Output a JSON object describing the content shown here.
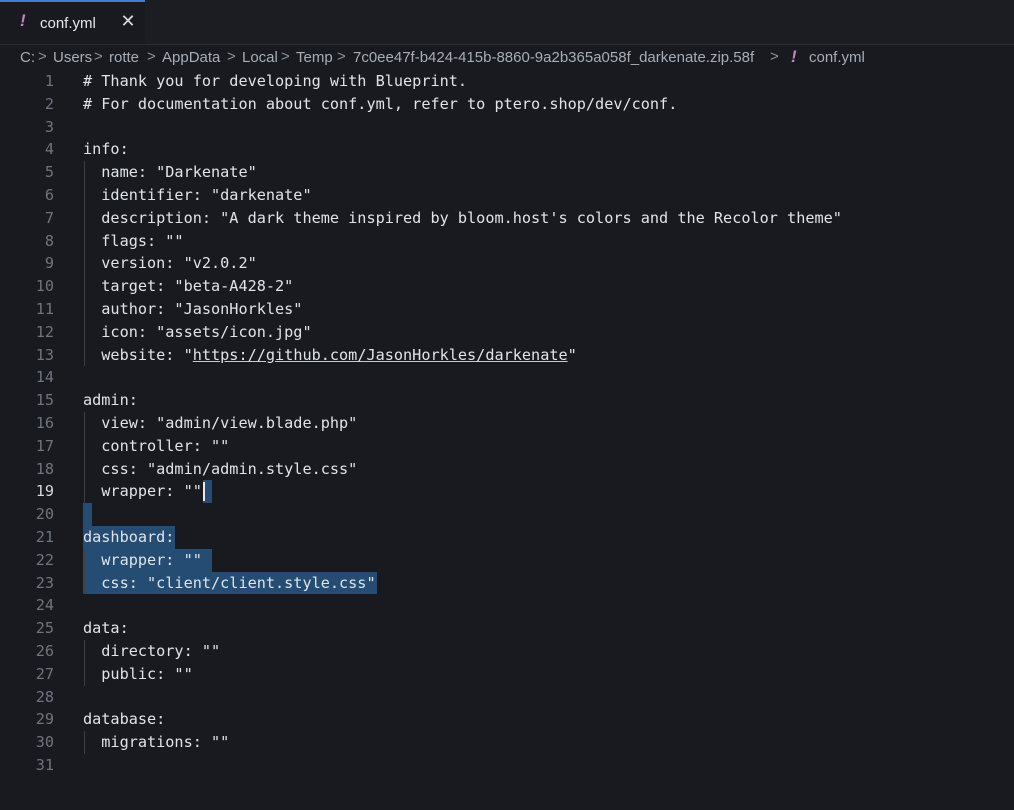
{
  "tab": {
    "icon": "!",
    "icon_name": "exclamation-icon",
    "label": "conf.yml",
    "close_glyph": "✕"
  },
  "breadcrumb": {
    "items": [
      "C:",
      "Users",
      "rotte",
      "AppData",
      "Local",
      "Temp",
      "7c0ee47f-b424-415b-8860-9a2b365a058f_darkenate.zip.58f"
    ],
    "separator": ">",
    "file_icon": "!",
    "file": "conf.yml"
  },
  "editor": {
    "active_line": 19,
    "lines": [
      "# Thank you for developing with Blueprint.",
      "# For documentation about conf.yml, refer to ptero.shop/dev/conf.",
      "",
      "info:",
      "  name: \"Darkenate\"",
      "  identifier: \"darkenate\"",
      "  description: \"A dark theme inspired by bloom.host's colors and the Recolor theme\"",
      "  flags: \"\"",
      "  version: \"v2.0.2\"",
      "  target: \"beta-A428-2\"",
      "  author: \"JasonHorkles\"",
      "  icon: \"assets/icon.jpg\"",
      "  website: \"https://github.com/JasonHorkles/darkenate\"",
      "",
      "admin:",
      "  view: \"admin/view.blade.php\"",
      "  controller: \"\"",
      "  css: \"admin/admin.style.css\"",
      "  wrapper: \"\"",
      "",
      "dashboard:",
      "  wrapper: \"\"",
      "  css: \"client/client.style.css\"",
      "",
      "data:",
      "  directory: \"\"",
      "  public: \"\"",
      "",
      "database:",
      "  migrations: \"\"",
      ""
    ]
  },
  "colors": {
    "accent": "#3d7ed1",
    "selection": "#264f78",
    "yaml_icon": "#c586c0",
    "background": "#181a1f"
  }
}
